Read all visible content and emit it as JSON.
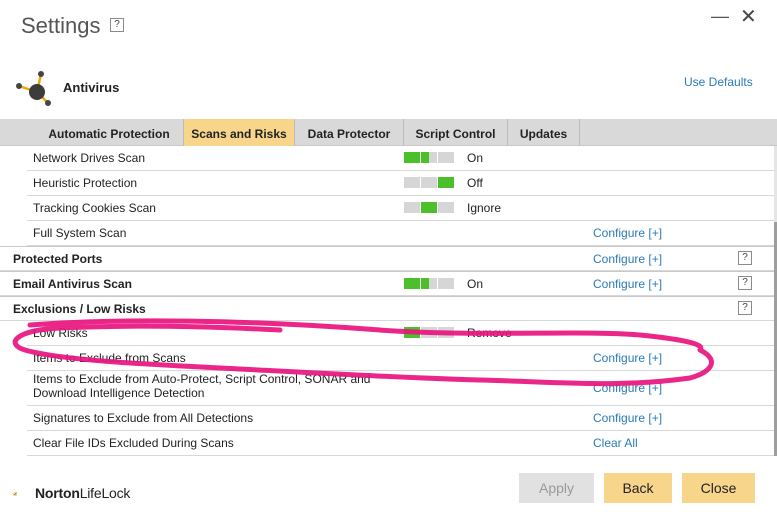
{
  "window": {
    "title": "Settings",
    "help": "?",
    "minimize_glyph": "—",
    "close_glyph": "✕"
  },
  "product": {
    "name": "Antivirus",
    "icon": "antivirus-icon",
    "use_defaults": "Use Defaults"
  },
  "tabs": [
    {
      "label": "Automatic Protection",
      "active": false
    },
    {
      "label": "Scans and Risks",
      "active": true
    },
    {
      "label": "Data Protector",
      "active": false
    },
    {
      "label": "Script Control",
      "active": false
    },
    {
      "label": "Updates",
      "active": false
    }
  ],
  "rows": {
    "network_drives": {
      "label": "Network Drives Scan",
      "state": "On"
    },
    "heuristic": {
      "label": "Heuristic Protection",
      "state": "Off"
    },
    "tracking_cookies": {
      "label": "Tracking Cookies Scan",
      "state": "Ignore"
    },
    "full_system": {
      "label": "Full System Scan",
      "action": "Configure [+]"
    },
    "protected_ports": {
      "label": "Protected Ports",
      "action": "Configure [+]",
      "help": "?"
    },
    "email_antivirus": {
      "label": "Email Antivirus Scan",
      "state": "On",
      "action": "Configure [+]",
      "help": "?"
    },
    "exclusions": {
      "label": "Exclusions / Low Risks",
      "help": "?"
    },
    "low_risks": {
      "label": "Low Risks",
      "state": "Remove"
    },
    "items_exclude_scans": {
      "label": "Items to Exclude from Scans",
      "action": "Configure [+]"
    },
    "items_exclude_autoprotect": {
      "label": "Items to Exclude from Auto-Protect, Script Control, SONAR and Download Intelligence Detection",
      "action": "Configure [+]"
    },
    "signatures_exclude": {
      "label": "Signatures to Exclude from All Detections",
      "action": "Configure [+]"
    },
    "clear_file_ids": {
      "label": "Clear File IDs Excluded During Scans",
      "action": "Clear All"
    }
  },
  "colors": {
    "accent": "#f7d58a",
    "slider_on": "#4cc02a",
    "link": "#2a7ab8",
    "annotation": "#e8157f"
  },
  "footer": {
    "brand_bold": "Norton",
    "brand_light": "LifeLock",
    "apply": "Apply",
    "back": "Back",
    "close": "Close"
  }
}
